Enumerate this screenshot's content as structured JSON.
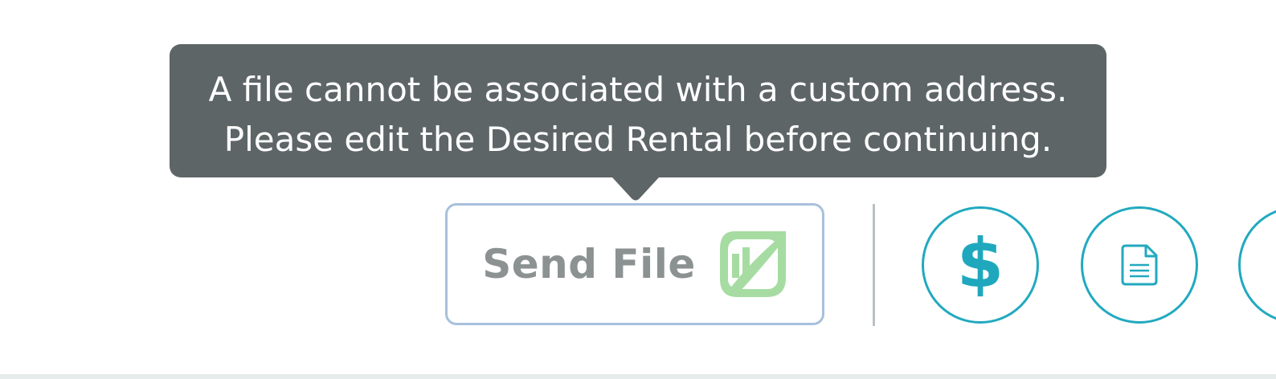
{
  "tooltip": {
    "line1": "A file cannot be associated with a custom address.",
    "line2": "Please edit the Desired Rental before continuing."
  },
  "send_file_button": {
    "label": "Send File",
    "icon": "brand-logo-icon"
  },
  "action_buttons": [
    {
      "icon": "dollar-icon",
      "glyph": "$"
    },
    {
      "icon": "document-icon"
    },
    {
      "icon": "unknown-partial-icon"
    }
  ],
  "colors": {
    "tooltip_background": "#5e6566",
    "tooltip_text": "#ffffff",
    "send_file_border": "#a8c0dc",
    "send_file_text": "#8c9191",
    "brand_green": "#a6dca2",
    "accent_teal": "#21a9bf",
    "divider": "#b8c2c4"
  }
}
